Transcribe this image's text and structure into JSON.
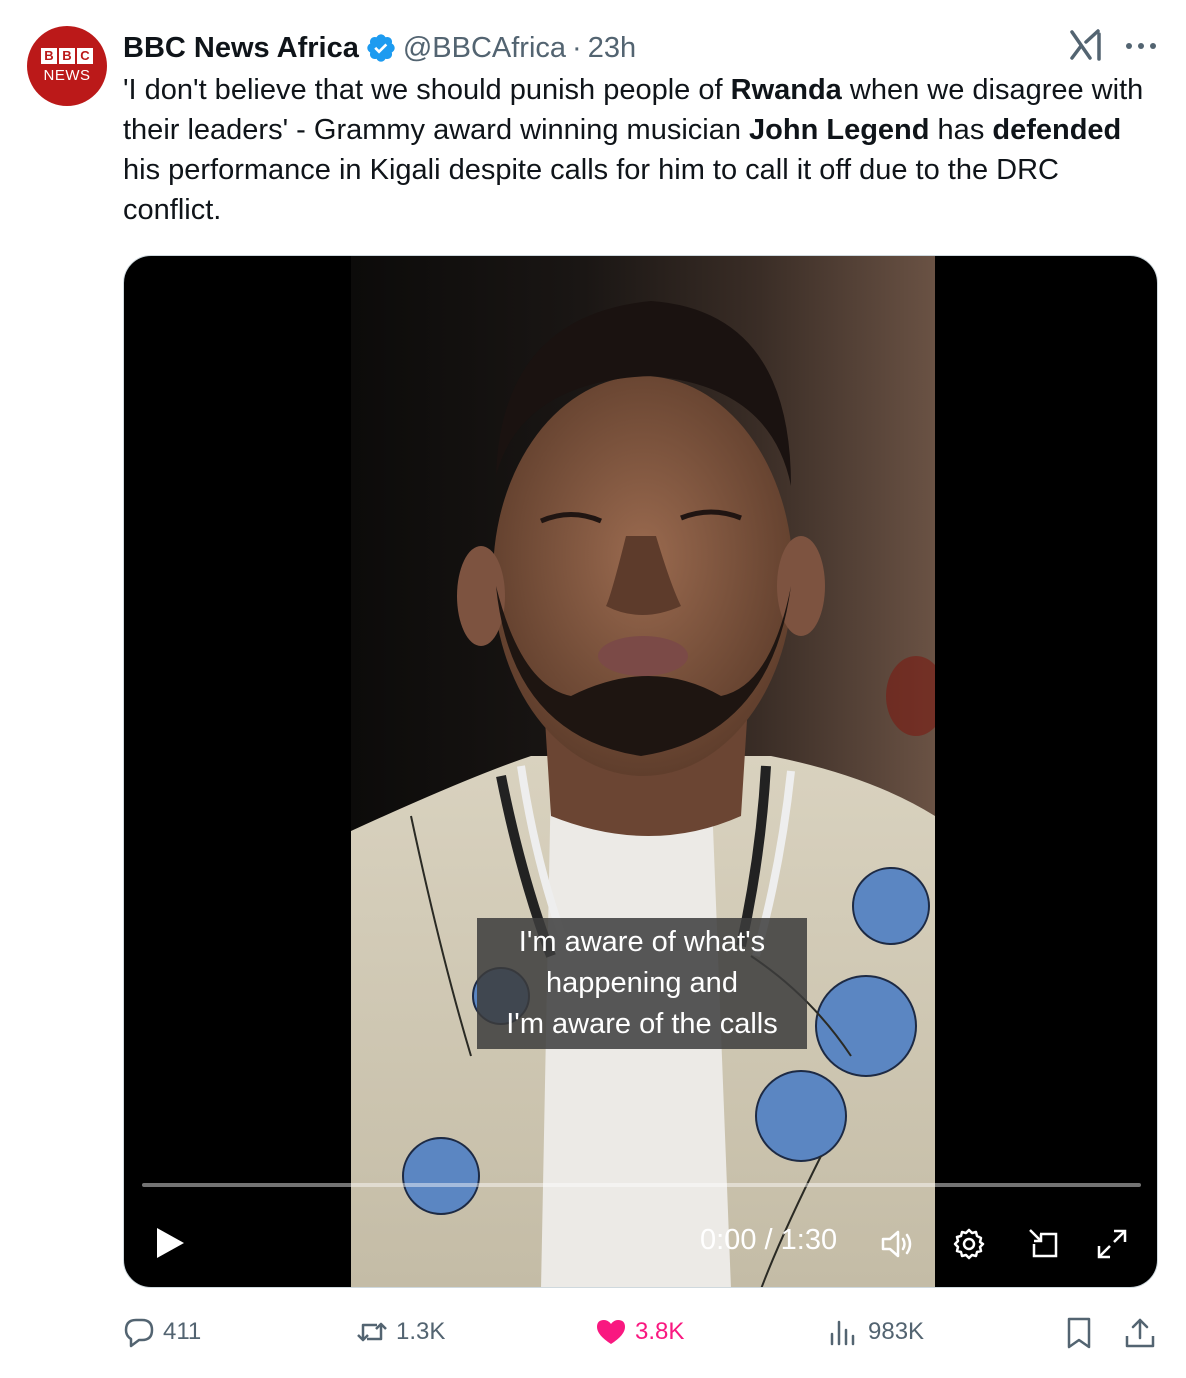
{
  "author": {
    "display_name": "BBC News Africa",
    "handle": "@BBCAfrica",
    "separator": "·",
    "time": "23h",
    "avatar": {
      "blocks": [
        "B",
        "B",
        "C"
      ],
      "word": "NEWS",
      "color": "#bb1919"
    },
    "verified_color": "#1d9bf0"
  },
  "tweet": {
    "segments": [
      {
        "text": "'I don't believe that we should punish people of ",
        "bold": false
      },
      {
        "text": "Rwanda",
        "bold": true
      },
      {
        "text": " when we disagree with their leaders' - Grammy award winning musician ",
        "bold": false
      },
      {
        "text": "John Legend",
        "bold": true
      },
      {
        "text": " has ",
        "bold": false
      },
      {
        "text": "defended",
        "bold": true
      },
      {
        "text": " his performance in Kigali despite calls for him to call it off due to the DRC conflict.",
        "bold": false
      }
    ]
  },
  "video": {
    "caption_lines": [
      "I'm aware of what's",
      "happening and",
      "I'm aware of the calls"
    ],
    "current_time": "0:00",
    "time_separator": "/",
    "duration": "1:30",
    "progress": 0,
    "controls": [
      "play-icon",
      "volume-icon",
      "settings-gear-icon",
      "picture-in-picture-icon",
      "fullscreen-icon"
    ]
  },
  "actions": {
    "replies": "411",
    "reposts": "1.3K",
    "likes": "3.8K",
    "views": "983K",
    "like_color": "#f91880",
    "muted_color": "#536471"
  }
}
